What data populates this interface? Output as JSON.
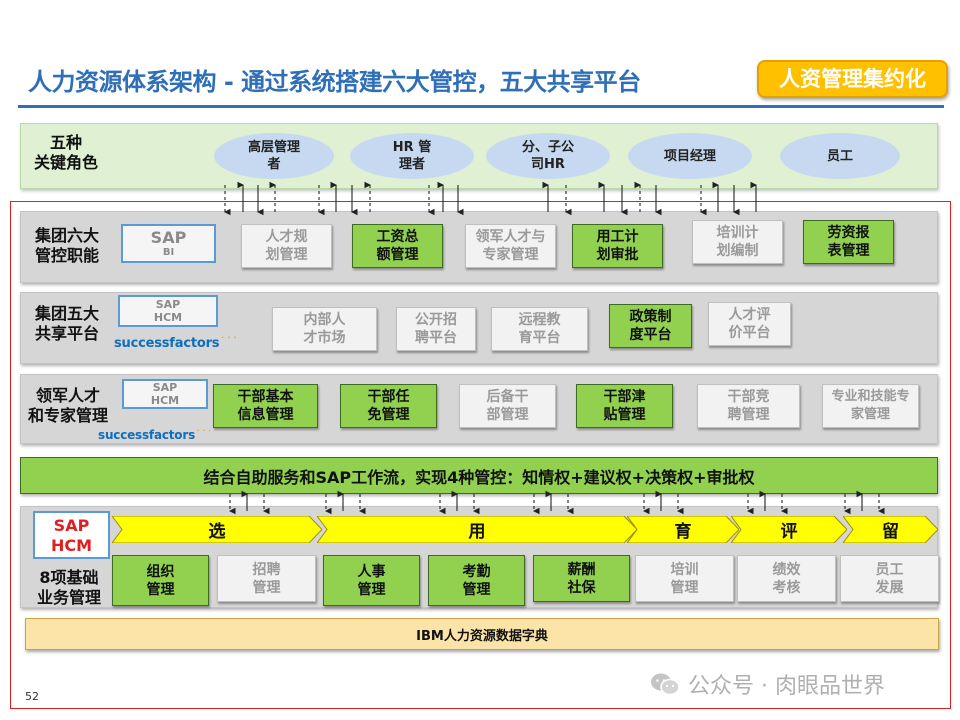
{
  "header": {
    "title": "人力资源体系架构 - 通过系统搭建六大管控，五大共享平台",
    "badge": "人资管理集约化"
  },
  "roles": {
    "label": "五种\n关键角色",
    "items": [
      "高层管理\n者",
      "HR  管\n理者",
      "分、子公\n司HR",
      "项目经理",
      "员工"
    ]
  },
  "group_six": {
    "label": "集团六大\n管控职能",
    "sap": {
      "big": "SAP",
      "small": "BI"
    },
    "boxes": [
      {
        "text": "人才规\n划管理",
        "style": "white"
      },
      {
        "text": "工资总\n额管理",
        "style": "green"
      },
      {
        "text": "领军人才与\n专家管理",
        "style": "white"
      },
      {
        "text": "用工计\n划审批",
        "style": "green"
      },
      {
        "text": "培训计\n划编制",
        "style": "white"
      },
      {
        "text": "劳资报\n表管理",
        "style": "green"
      }
    ]
  },
  "group_five": {
    "label": "集团五大\n共享平台",
    "sap": {
      "line1": "SAP",
      "line2": "HCM"
    },
    "logo": {
      "main": "successfactors",
      "dots": "˙˙˙"
    },
    "boxes": [
      {
        "text": "内部人\n才市场",
        "style": "white"
      },
      {
        "text": "公开招\n聘平台",
        "style": "white"
      },
      {
        "text": "远程教\n育平台",
        "style": "white"
      },
      {
        "text": "政策制\n度平台",
        "style": "green"
      },
      {
        "text": "人才评\n价平台",
        "style": "white"
      }
    ]
  },
  "talent": {
    "label": "领军人才\n和专家管理",
    "sap": {
      "line1": "SAP",
      "line2": "HCM"
    },
    "logo": {
      "main": "successfactors",
      "dots": "˙˙˙"
    },
    "boxes": [
      {
        "text": "干部基本\n信息管理",
        "style": "green"
      },
      {
        "text": "干部任\n免管理",
        "style": "green"
      },
      {
        "text": "后备干\n部管理",
        "style": "white"
      },
      {
        "text": "干部津\n贴管理",
        "style": "green"
      },
      {
        "text": "干部竞\n聘管理",
        "style": "white"
      },
      {
        "text": "专业和技能专\n家管理",
        "style": "white"
      }
    ]
  },
  "control_bar": "结合自助服务和SAP工作流，实现4种管控：知情权+建议权+决策权+审批权",
  "basics": {
    "hcm": "SAP\nHCM",
    "label": "8项基础\n业务管理",
    "stages": [
      "选",
      "用",
      "育",
      "评",
      "留"
    ],
    "boxes": [
      {
        "text": "组织\n管理",
        "style": "green"
      },
      {
        "text": "招聘\n管理",
        "style": "white"
      },
      {
        "text": "人事\n管理",
        "style": "green"
      },
      {
        "text": "考勤\n管理",
        "style": "green"
      },
      {
        "text": "薪酬\n社保",
        "style": "green"
      },
      {
        "text": "培训\n管理",
        "style": "white"
      },
      {
        "text": "绩效\n考核",
        "style": "white"
      },
      {
        "text": "员工\n发展",
        "style": "white"
      }
    ],
    "dictionary": "IBM人力资源数据字典"
  },
  "footer": {
    "page": "52",
    "watermark": "公众号 · 肉眼品世界"
  },
  "colors": {
    "title_blue": "#2e6fb7",
    "green": "#92d050",
    "gray_band": "#d6d6d6",
    "role_band": "#dff0d3",
    "ellipse": "#c6d9f1",
    "badge": "#ffc000",
    "chevron": "#ffff00",
    "red_frame": "#e02020"
  }
}
